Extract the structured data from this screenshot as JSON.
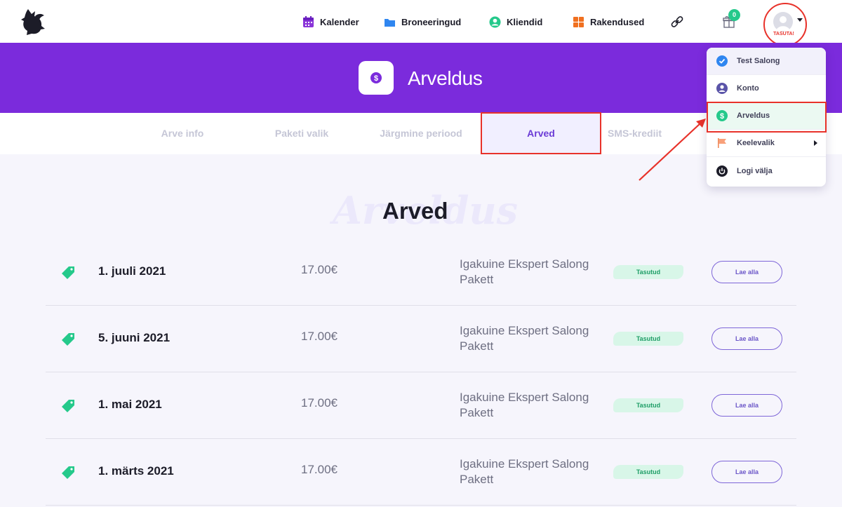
{
  "nav": {
    "calendar": "Kalender",
    "bookings": "Broneeringud",
    "clients": "Kliendid",
    "apps": "Rakendused",
    "gift_count": "0",
    "plan_tag": "TASUTA!"
  },
  "header": {
    "title": "Arveldus",
    "watermark": "Arveldus"
  },
  "tabs": [
    {
      "label": "Arve info"
    },
    {
      "label": "Paketi valik"
    },
    {
      "label": "Järgmine periood"
    },
    {
      "label": "Arved"
    },
    {
      "label": "SMS-krediit"
    }
  ],
  "main": {
    "title": "Arved"
  },
  "invoices": [
    {
      "date": "1. juuli 2021",
      "amount": "17.00€",
      "package": "Igakuine Ekspert Salong Pakett",
      "status": "Tasutud",
      "action": "Lae alla"
    },
    {
      "date": "5. juuni 2021",
      "amount": "17.00€",
      "package": "Igakuine Ekspert Salong Pakett",
      "status": "Tasutud",
      "action": "Lae alla"
    },
    {
      "date": "1. mai 2021",
      "amount": "17.00€",
      "package": "Igakuine Ekspert Salong Pakett",
      "status": "Tasutud",
      "action": "Lae alla"
    },
    {
      "date": "1. märts 2021",
      "amount": "17.00€",
      "package": "Igakuine Ekspert Salong Pakett",
      "status": "Tasutud",
      "action": "Lae alla"
    }
  ],
  "menu": [
    {
      "label": "Test Salong"
    },
    {
      "label": "Konto"
    },
    {
      "label": "Arveldus"
    },
    {
      "label": "Keelevalik"
    },
    {
      "label": "Logi välja"
    }
  ],
  "colors": {
    "brand": "#7b2bdc",
    "accent": "#6b3bd6",
    "success": "#25c98b",
    "annotation": "#e8322a"
  }
}
